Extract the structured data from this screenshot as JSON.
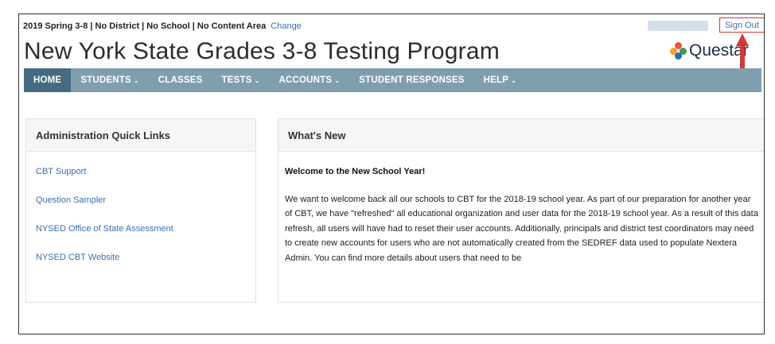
{
  "header": {
    "context": "2019 Spring 3-8 | No District | No School | No Content Area",
    "change_link": "Change",
    "sign_out": "Sign Out",
    "app_title": "New York State Grades 3-8 Testing Program",
    "logo_text": "Questar"
  },
  "nav": {
    "items": [
      {
        "label": "HOME",
        "caret": ""
      },
      {
        "label": "STUDENTS",
        "caret": "⌄"
      },
      {
        "label": "CLASSES",
        "caret": ""
      },
      {
        "label": "TESTS",
        "caret": "⌄"
      },
      {
        "label": "ACCOUNTS",
        "caret": "⌄"
      },
      {
        "label": "STUDENT RESPONSES",
        "caret": ""
      },
      {
        "label": "HELP",
        "caret": "⌄"
      }
    ]
  },
  "quick_links": {
    "title": "Administration Quick Links",
    "links": [
      "CBT Support",
      "Question Sampler",
      "NYSED Office of State Assessment",
      "NYSED CBT Website"
    ]
  },
  "whats_new": {
    "title": "What's New",
    "headline": "Welcome to the New School Year!",
    "body": "We want to welcome back all our schools to CBT for the 2018-19 school year. As part of our preparation for another year of CBT, we have \"refreshed\" all educational organization and user data for the 2018-19 school year. As a result of this data refresh, all users will have had to reset their user accounts. Additionally, principals and district test coordinators may need to create new accounts for users who are not automatically created from the SEDREF data used to populate Nextera Admin. You can find more details about users that need to be"
  },
  "colors": {
    "nav_bg": "#7f9fae",
    "nav_active": "#456b80",
    "link": "#3a6fb0",
    "highlight_red": "#d23a3a"
  }
}
